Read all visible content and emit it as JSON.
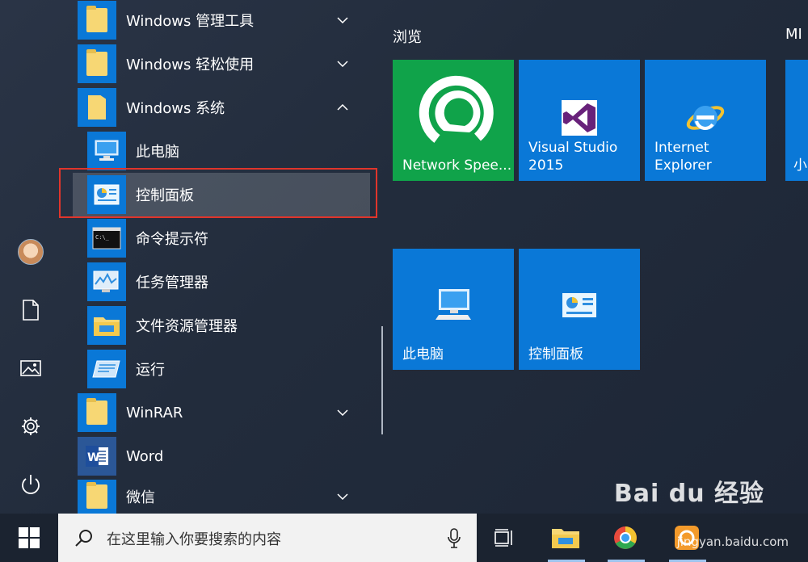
{
  "app_list": {
    "folders": [
      {
        "label": "Windows 管理工具",
        "expanded": false
      },
      {
        "label": "Windows 轻松使用",
        "expanded": false
      },
      {
        "label": "Windows 系统",
        "expanded": true
      }
    ],
    "system_items": [
      {
        "label": "此电脑",
        "icon": "computer-icon"
      },
      {
        "label": "控制面板",
        "icon": "control-panel-icon",
        "selected": true
      },
      {
        "label": "命令提示符",
        "icon": "cmd-icon"
      },
      {
        "label": "任务管理器",
        "icon": "task-manager-icon"
      },
      {
        "label": "文件资源管理器",
        "icon": "file-explorer-icon"
      },
      {
        "label": "运行",
        "icon": "run-icon"
      }
    ],
    "more": [
      {
        "label": "WinRAR",
        "icon": "folder-icon",
        "expandable": true
      },
      {
        "label": "Word",
        "icon": "word-icon",
        "expandable": false
      },
      {
        "label": "微信",
        "icon": "folder-icon",
        "expandable": true
      }
    ]
  },
  "tiles": {
    "group1_title": "浏览",
    "group2_title": "MI",
    "row1": [
      {
        "label": "Network Spee...",
        "color": "#10a34a",
        "icon": "network-speed-icon"
      },
      {
        "label": "Visual Studio\n2015",
        "color": "#0a78d7",
        "icon": "visual-studio-icon"
      },
      {
        "label": "Internet\nExplorer",
        "color": "#0a78d7",
        "icon": "internet-explorer-icon"
      },
      {
        "label": "小",
        "color": "#0a78d7",
        "icon": ""
      }
    ],
    "row2": [
      {
        "label": "此电脑",
        "color": "#0a78d7",
        "icon": "computer-icon"
      },
      {
        "label": "控制面板",
        "color": "#0a78d7",
        "icon": "control-panel-icon"
      }
    ]
  },
  "taskbar": {
    "search_placeholder": "在这里输入你要搜索的内容"
  },
  "watermark": {
    "brand": "Bai du 经验",
    "url": "jingyan.baidu.com"
  }
}
